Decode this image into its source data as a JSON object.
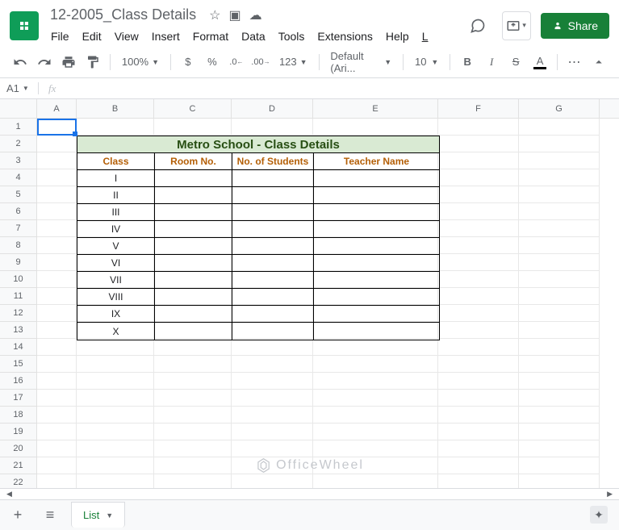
{
  "header": {
    "doc_title": "12-2005_Class Details",
    "share": "Share"
  },
  "menubar": [
    "File",
    "Edit",
    "View",
    "Insert",
    "Format",
    "Data",
    "Tools",
    "Extensions",
    "Help",
    "L"
  ],
  "toolbar": {
    "zoom": "100%",
    "currency": "$",
    "percent": "%",
    "dec_dec": ".0",
    "dec_inc": ".00",
    "more_fmt": "123",
    "font": "Default (Ari...",
    "font_size": "10",
    "bold": "B",
    "italic": "I",
    "strike": "S",
    "text_color": "A",
    "more": "⋯"
  },
  "name_box": "A1",
  "fx_label": "fx",
  "columns": [
    "A",
    "B",
    "C",
    "D",
    "E",
    "F",
    "G"
  ],
  "rows": [
    "1",
    "2",
    "3",
    "4",
    "5",
    "6",
    "7",
    "8",
    "9",
    "10",
    "11",
    "12",
    "13",
    "14",
    "15",
    "16",
    "17",
    "18",
    "19",
    "20",
    "21",
    "22"
  ],
  "sheet_data": {
    "title": "Metro School - Class Details",
    "headers": {
      "class": "Class",
      "room": "Room No.",
      "students": "No. of Students",
      "teacher": "Teacher Name"
    },
    "classes": [
      "I",
      "II",
      "III",
      "IV",
      "V",
      "VI",
      "VII",
      "VIII",
      "IX",
      "X"
    ]
  },
  "sheet_tab": "List",
  "watermark": "OfficeWheel"
}
